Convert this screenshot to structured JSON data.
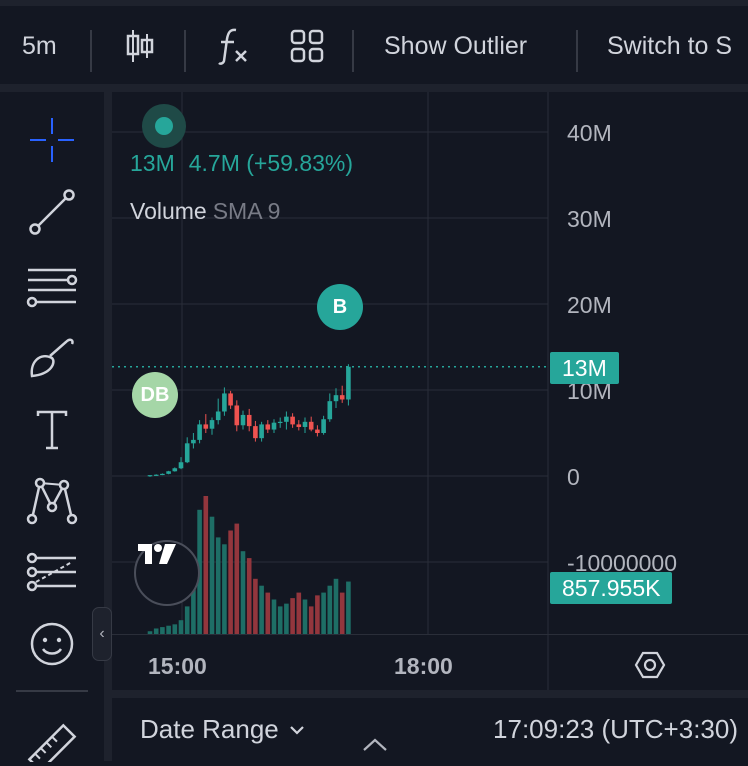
{
  "toolbar": {
    "interval": "5m",
    "show_outlier": "Show Outlier",
    "switch_to": "Switch to S"
  },
  "legend": {
    "value": "13M",
    "change": "4.7M (+59.83%)",
    "indicator": "Volume",
    "indicator_param": "SMA 9"
  },
  "price_axis": {
    "labels": [
      "40M",
      "30M",
      "20M",
      "10M",
      "0",
      "-10000000"
    ],
    "last_value_tag": "13M",
    "volume_tag": "857.955K",
    "accent": "#26a69a"
  },
  "markers": {
    "buy": "B",
    "double_bottom": "DB"
  },
  "time_axis": {
    "labels": [
      "15:00",
      "18:00"
    ]
  },
  "bottom": {
    "date_range": "Date Range",
    "clock": "17:09:23 (UTC+3:30)"
  },
  "chart_data": {
    "type": "candlestick",
    "interval": "5m",
    "ylim": [
      -10000000,
      40000000
    ],
    "up_color": "#26a69a",
    "down_color": "#ef5350",
    "candles": [
      {
        "o": 0.0,
        "h": 0.1,
        "l": -0.1,
        "c": 0.1
      },
      {
        "o": 0.1,
        "h": 0.2,
        "l": 0.0,
        "c": 0.15
      },
      {
        "o": 0.15,
        "h": 0.3,
        "l": 0.1,
        "c": 0.25
      },
      {
        "o": 0.25,
        "h": 0.6,
        "l": 0.2,
        "c": 0.55
      },
      {
        "o": 0.55,
        "h": 1.0,
        "l": 0.5,
        "c": 0.9
      },
      {
        "o": 0.9,
        "h": 2.2,
        "l": 0.8,
        "c": 1.6
      },
      {
        "o": 1.6,
        "h": 4.5,
        "l": 1.5,
        "c": 3.8
      },
      {
        "o": 3.8,
        "h": 5.0,
        "l": 3.2,
        "c": 4.2
      },
      {
        "o": 4.2,
        "h": 6.5,
        "l": 3.8,
        "c": 6.0
      },
      {
        "o": 6.0,
        "h": 7.2,
        "l": 5.0,
        "c": 5.5
      },
      {
        "o": 5.5,
        "h": 6.8,
        "l": 4.8,
        "c": 6.5
      },
      {
        "o": 6.5,
        "h": 9.0,
        "l": 6.0,
        "c": 7.5
      },
      {
        "o": 7.5,
        "h": 10.3,
        "l": 7.0,
        "c": 9.6
      },
      {
        "o": 9.6,
        "h": 9.9,
        "l": 7.8,
        "c": 8.2
      },
      {
        "o": 8.2,
        "h": 8.8,
        "l": 5.2,
        "c": 5.9
      },
      {
        "o": 5.9,
        "h": 7.6,
        "l": 5.4,
        "c": 7.1
      },
      {
        "o": 7.1,
        "h": 7.8,
        "l": 5.2,
        "c": 5.8
      },
      {
        "o": 5.8,
        "h": 6.4,
        "l": 4.0,
        "c": 4.4
      },
      {
        "o": 4.4,
        "h": 6.3,
        "l": 4.0,
        "c": 6.0
      },
      {
        "o": 6.0,
        "h": 6.5,
        "l": 5.0,
        "c": 5.4
      },
      {
        "o": 5.4,
        "h": 6.6,
        "l": 5.0,
        "c": 6.2
      },
      {
        "o": 6.2,
        "h": 6.8,
        "l": 5.6,
        "c": 6.3
      },
      {
        "o": 6.3,
        "h": 7.5,
        "l": 5.4,
        "c": 6.9
      },
      {
        "o": 6.9,
        "h": 7.3,
        "l": 5.6,
        "c": 6.0
      },
      {
        "o": 6.0,
        "h": 6.5,
        "l": 5.3,
        "c": 5.7
      },
      {
        "o": 5.7,
        "h": 6.8,
        "l": 5.0,
        "c": 6.3
      },
      {
        "o": 6.3,
        "h": 6.9,
        "l": 5.2,
        "c": 5.4
      },
      {
        "o": 5.4,
        "h": 5.9,
        "l": 4.6,
        "c": 5.0
      },
      {
        "o": 5.0,
        "h": 7.0,
        "l": 4.8,
        "c": 6.6
      },
      {
        "o": 6.6,
        "h": 9.6,
        "l": 6.3,
        "c": 8.7
      },
      {
        "o": 8.7,
        "h": 10.2,
        "l": 7.9,
        "c": 9.4
      },
      {
        "o": 9.4,
        "h": 10.5,
        "l": 8.5,
        "c": 8.9
      },
      {
        "o": 8.9,
        "h": 13.0,
        "l": 8.2,
        "c": 12.7
      }
    ],
    "volume": [
      0.02,
      0.04,
      0.05,
      0.06,
      0.07,
      0.1,
      0.2,
      0.5,
      0.9,
      1.0,
      0.85,
      0.7,
      0.65,
      0.75,
      0.8,
      0.6,
      0.55,
      0.4,
      0.35,
      0.3,
      0.25,
      0.2,
      0.22,
      0.26,
      0.3,
      0.25,
      0.2,
      0.28,
      0.3,
      0.35,
      0.4,
      0.3,
      0.38
    ]
  }
}
